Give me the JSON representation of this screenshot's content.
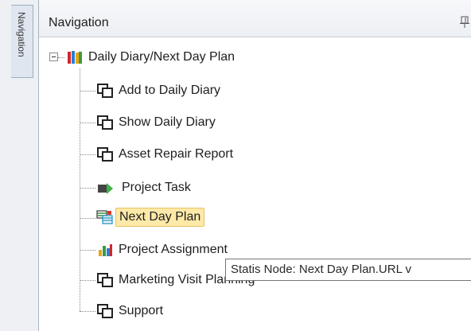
{
  "side_tab": {
    "label": "Navigation"
  },
  "panel": {
    "title": "Navigation"
  },
  "tree": {
    "root": {
      "label": "Daily Diary/Next Day Plan",
      "icon": "books-folder-icon"
    },
    "items": [
      {
        "label": "Add to Daily Diary",
        "icon": "window-copy-icon"
      },
      {
        "label": "Show Daily Diary",
        "icon": "window-copy-icon"
      },
      {
        "label": "Asset Repair Report",
        "icon": "window-copy-icon"
      },
      {
        "label": "Project Task",
        "icon": "green-arrow-task-icon"
      },
      {
        "label": "Next Day Plan",
        "icon": "calendar-grid-icon",
        "selected": true
      },
      {
        "label": "Project Assignment",
        "icon": "bar-chart-icon"
      },
      {
        "label": "Marketing Visit Planning",
        "icon": "window-copy-icon"
      },
      {
        "label": "Support",
        "icon": "window-copy-icon"
      }
    ]
  },
  "tooltip": {
    "text": "Statis Node: Next Day Plan.URL v"
  },
  "colors": {
    "selection": "#fde9a8",
    "selection_border": "#e5c365",
    "header": "#eceff3"
  }
}
